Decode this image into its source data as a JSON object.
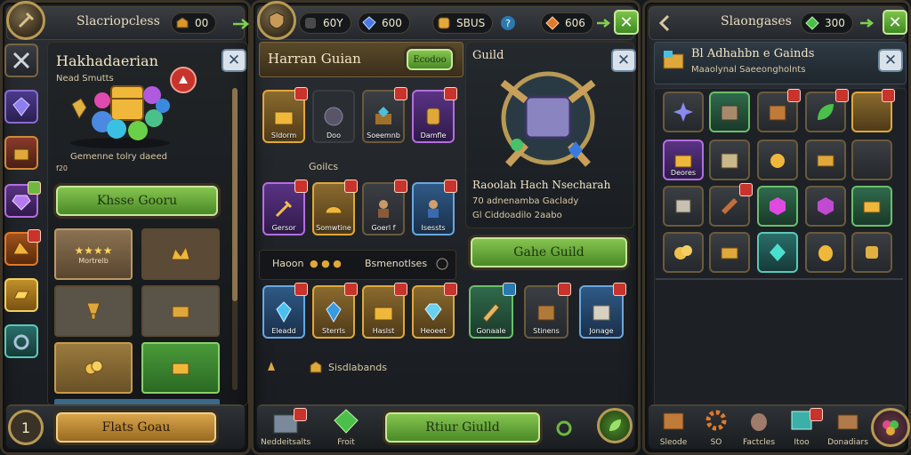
{
  "colors": {
    "accent_green": "#6fb83e",
    "gold": "#e0a83a",
    "close_blue": "#2f4b64"
  },
  "p1": {
    "top": {
      "title": "Slacriopcless",
      "gold_count": "00"
    },
    "heading": "Hakhadaerian",
    "subheading": "Nead Smutts",
    "desc": "Gemenne tolry daeed",
    "desc_small": "f20",
    "btn": "Khsse Gooru",
    "tiles": [
      {
        "label": "Mortrelb"
      }
    ],
    "bottom_btn": "Flats Goau",
    "bottom_left": "1"
  },
  "p2": {
    "top": {
      "c1": "60Y",
      "c2": "600",
      "c3": "SBUS",
      "c4": "606"
    },
    "heading": "Harran Guian",
    "badge": "Ecodoo",
    "row1_labels": [
      "Sldorm",
      "Doo",
      "Soeemnb",
      "Damfle"
    ],
    "section": "Goilcs",
    "row2_labels": [
      "Gersor",
      "Somwtine",
      "Goerl f",
      "Isessts"
    ],
    "bar_left": "Haoon",
    "bar_right": "Bsmenotlses",
    "row3_labels": [
      "Eleadd",
      "Sterrls",
      "Haslst",
      "Heoeet"
    ],
    "footer": "Sisdlabands",
    "bottom_btn": "Rtiur Giulld",
    "nav": [
      "Neddeitsalts",
      "Froit"
    ]
  },
  "guild": {
    "title": "Guild",
    "name": "Raoolah Hach Nsecharah",
    "info": "70 adnenamba Gaclady",
    "info2": "Gl Ciddoadilo 2aabo",
    "btn": "Gahe Guild",
    "labels": [
      "Gonaale",
      "Stinens",
      "Jonage"
    ]
  },
  "p3": {
    "top": {
      "title": "Slaongases",
      "gem_count": "300"
    },
    "heading": "Bl Adhahbn e Gainds",
    "subheading": "Maaolynal Saeeongholnts",
    "row2_label": "Deores",
    "nav": [
      "Sleode",
      "SO",
      "Factcles",
      "Itoo",
      "Donadiars"
    ]
  }
}
